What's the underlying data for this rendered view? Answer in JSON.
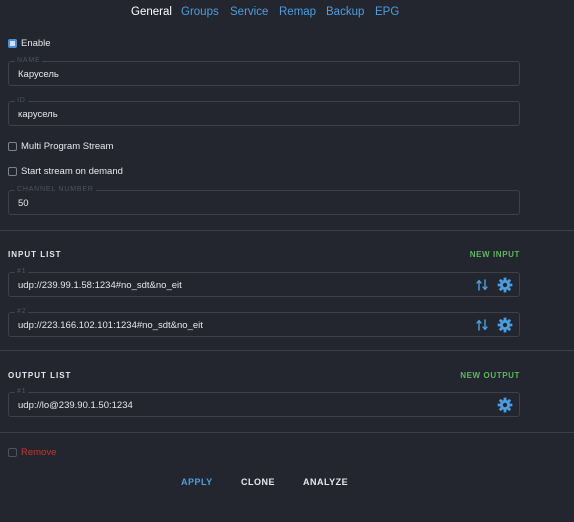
{
  "tabs": [
    {
      "label": "General",
      "active": true
    },
    {
      "label": "Groups"
    },
    {
      "label": "Service"
    },
    {
      "label": "Remap"
    },
    {
      "label": "Backup"
    },
    {
      "label": "EPG"
    }
  ],
  "general": {
    "enable_label": "Enable",
    "enable_checked": true,
    "name": {
      "legend": "NAME",
      "value": "Карусель"
    },
    "id": {
      "legend": "ID",
      "value": "карусель"
    },
    "multi_program_label": "Multi Program Stream",
    "start_on_demand_label": "Start stream on demand",
    "channel_number": {
      "legend": "CHANNEL NUMBER",
      "value": "50"
    }
  },
  "input_list": {
    "title": "INPUT LIST",
    "action": "NEW INPUT",
    "items": [
      {
        "legend": "#1",
        "value": "udp://239.99.1.58:1234#no_sdt&no_eit"
      },
      {
        "legend": "#2",
        "value": "udp://223.166.102.101:1234#no_sdt&no_eit"
      }
    ]
  },
  "output_list": {
    "title": "OUTPUT LIST",
    "action": "NEW OUTPUT",
    "items": [
      {
        "legend": "#1",
        "value": "udp://lo@239.90.1.50:1234"
      }
    ]
  },
  "remove_label": "Remove",
  "footer": {
    "apply": "APPLY",
    "clone": "CLONE",
    "analyze": "ANALYZE"
  },
  "colors": {
    "background": "#23262f",
    "accent": "#4a9fe0",
    "add_action": "#5cb85c",
    "danger": "#c8352f"
  },
  "icons": [
    "sort-arrows-icon",
    "gear-icon"
  ]
}
